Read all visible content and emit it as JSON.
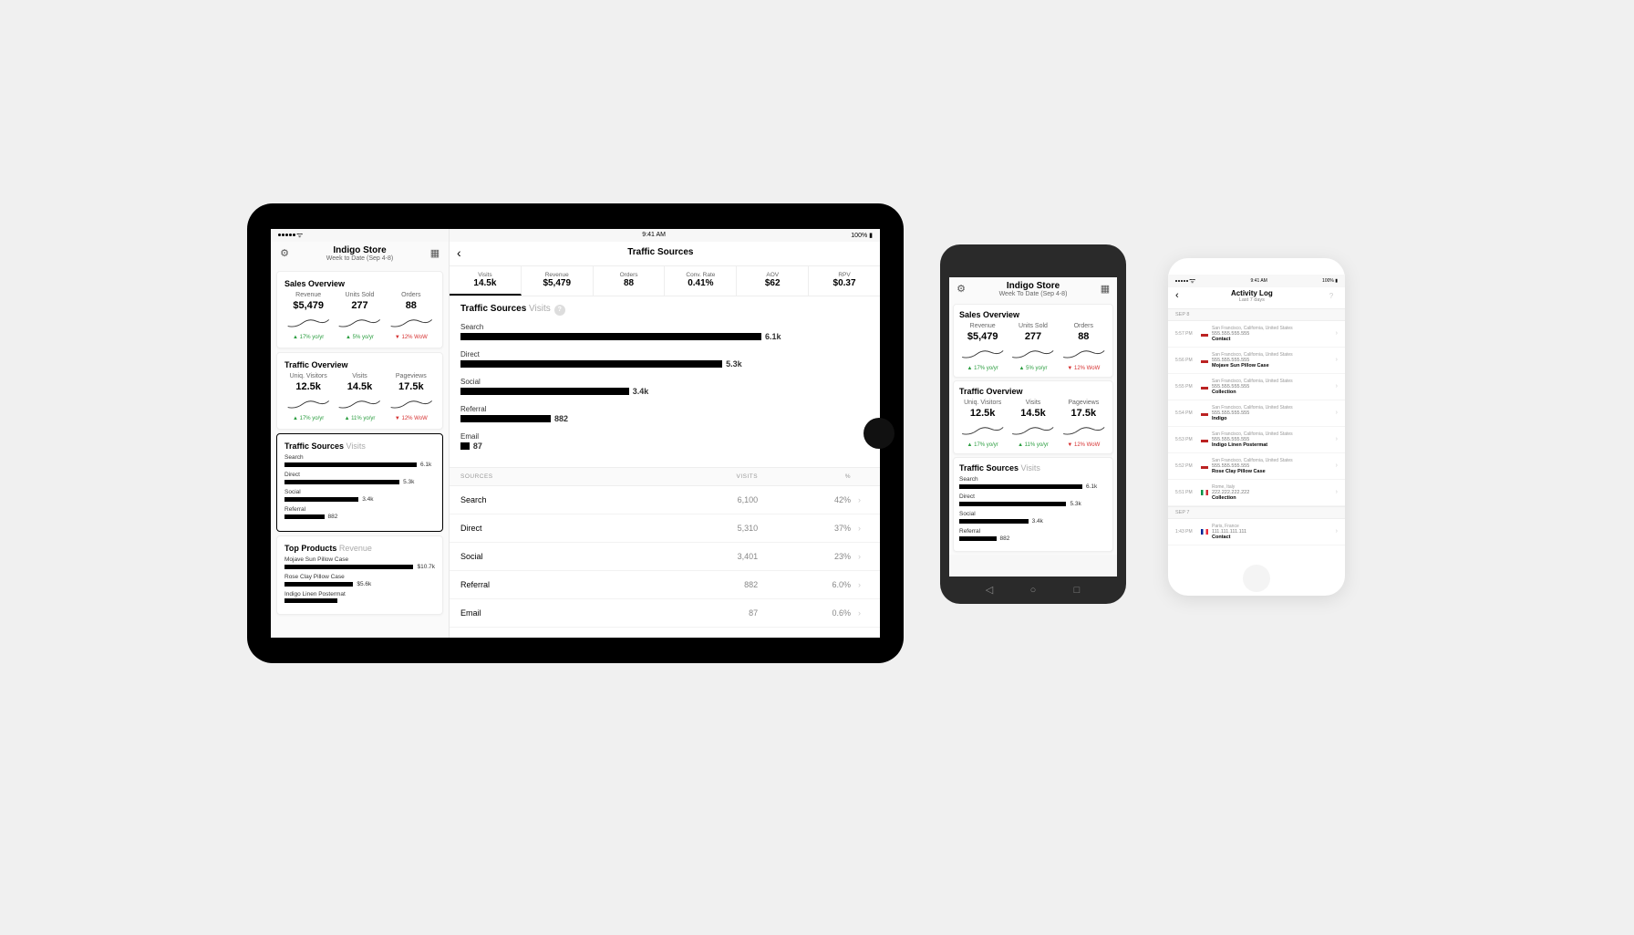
{
  "status": {
    "time": "9:41 AM",
    "battery": "100%"
  },
  "store": {
    "name": "Indigo Store",
    "period": "Week to Date (Sep 4-8)",
    "period_alt": "Week To Date (Sep 4-8)"
  },
  "sales": {
    "title": "Sales Overview",
    "metrics": [
      {
        "label": "Revenue",
        "value": "$5,479",
        "delta": "▲ 17% yo/yr",
        "dir": "up"
      },
      {
        "label": "Units Sold",
        "value": "277",
        "delta": "▲ 5% yo/yr",
        "dir": "up"
      },
      {
        "label": "Orders",
        "value": "88",
        "delta": "▼ 12% WoW",
        "dir": "down"
      }
    ]
  },
  "traffic_overview": {
    "title": "Traffic Overview",
    "metrics": [
      {
        "label": "Uniq. Visitors",
        "value": "12.5k",
        "delta": "▲ 17% yo/yr",
        "dir": "up"
      },
      {
        "label": "Visits",
        "value": "14.5k",
        "delta": "▲ 11% yo/yr",
        "dir": "up"
      },
      {
        "label": "Pageviews",
        "value": "17.5k",
        "delta": "▼ 12% WoW",
        "dir": "down"
      }
    ]
  },
  "traffic_sources": {
    "title": "Traffic Sources",
    "subtitle": "Visits",
    "bars": [
      {
        "label": "Search",
        "value": "6.1k",
        "pct": 100
      },
      {
        "label": "Direct",
        "value": "5.3k",
        "pct": 87
      },
      {
        "label": "Social",
        "value": "3.4k",
        "pct": 56
      },
      {
        "label": "Referral",
        "value": "882",
        "pct": 30
      },
      {
        "label": "Email",
        "value": "87",
        "pct": 3
      }
    ]
  },
  "top_products": {
    "title": "Top Products",
    "subtitle": "Revenue",
    "items": [
      {
        "label": "Mojave Sun Pillow Case",
        "value": "$10.7k",
        "pct": 100
      },
      {
        "label": "Rose Clay Pillow Case",
        "value": "$5.6k",
        "pct": 52
      },
      {
        "label": "Indigo Linen Postermat",
        "value": "",
        "pct": 40
      }
    ]
  },
  "main": {
    "title": "Traffic Sources",
    "tabs": [
      {
        "label": "Visits",
        "value": "14.5k",
        "active": true
      },
      {
        "label": "Revenue",
        "value": "$5,479"
      },
      {
        "label": "Orders",
        "value": "88"
      },
      {
        "label": "Conv. Rate",
        "value": "0.41%"
      },
      {
        "label": "AOV",
        "value": "$62"
      },
      {
        "label": "RPV",
        "value": "$0.37"
      }
    ],
    "section_title": "Traffic Sources",
    "section_sub": "Visits",
    "table": {
      "headers": [
        "SOURCES",
        "VISITS",
        "%"
      ],
      "rows": [
        {
          "source": "Search",
          "visits": "6,100",
          "pct": "42%"
        },
        {
          "source": "Direct",
          "visits": "5,310",
          "pct": "37%"
        },
        {
          "source": "Social",
          "visits": "3,401",
          "pct": "23%"
        },
        {
          "source": "Referral",
          "visits": "882",
          "pct": "6.0%"
        },
        {
          "source": "Email",
          "visits": "87",
          "pct": "0.6%"
        }
      ]
    }
  },
  "activity": {
    "title": "Activity Log",
    "subtitle": "Last 7 days",
    "groups": [
      {
        "date": "SEP 8",
        "rows": [
          {
            "time": "5:57 PM",
            "flag": "us",
            "loc": "San Francisco, California, United States",
            "ip": "555.555.555.555",
            "action": "Contact"
          },
          {
            "time": "5:56 PM",
            "flag": "us",
            "loc": "San Francisco, California, United States",
            "ip": "555.555.555.555",
            "action": "Mojave Sun Pillow Case"
          },
          {
            "time": "5:55 PM",
            "flag": "us",
            "loc": "San Francisco, California, United States",
            "ip": "555.555.555.555",
            "action": "Collection"
          },
          {
            "time": "5:54 PM",
            "flag": "us",
            "loc": "San Francisco, California, United States",
            "ip": "555.555.555.555",
            "action": "Indigo"
          },
          {
            "time": "5:53 PM",
            "flag": "us",
            "loc": "San Francisco, California, United States",
            "ip": "555.555.555.555",
            "action": "Indigo Linen Postermat"
          },
          {
            "time": "5:52 PM",
            "flag": "us",
            "loc": "San Francisco, California, United States",
            "ip": "555.555.555.555",
            "action": "Rose Clay Pillow Case"
          },
          {
            "time": "5:51 PM",
            "flag": "it",
            "loc": "Rome, Italy",
            "ip": "222.222.222.222",
            "action": "Collection"
          }
        ]
      },
      {
        "date": "SEP 7",
        "rows": [
          {
            "time": "1:43 PM",
            "flag": "fr",
            "loc": "Paris, France",
            "ip": "111.111.111.111",
            "action": "Contact"
          }
        ]
      }
    ]
  },
  "chart_data": [
    {
      "type": "bar",
      "title": "Traffic Sources — Visits",
      "categories": [
        "Search",
        "Direct",
        "Social",
        "Referral",
        "Email"
      ],
      "values": [
        6100,
        5310,
        3401,
        882,
        87
      ],
      "xlabel": "",
      "ylabel": "Visits"
    },
    {
      "type": "bar",
      "title": "Top Products — Revenue",
      "categories": [
        "Mojave Sun Pillow Case",
        "Rose Clay Pillow Case",
        "Indigo Linen Postermat"
      ],
      "values": [
        10700,
        5600,
        4300
      ],
      "ylabel": "Revenue ($)"
    }
  ]
}
